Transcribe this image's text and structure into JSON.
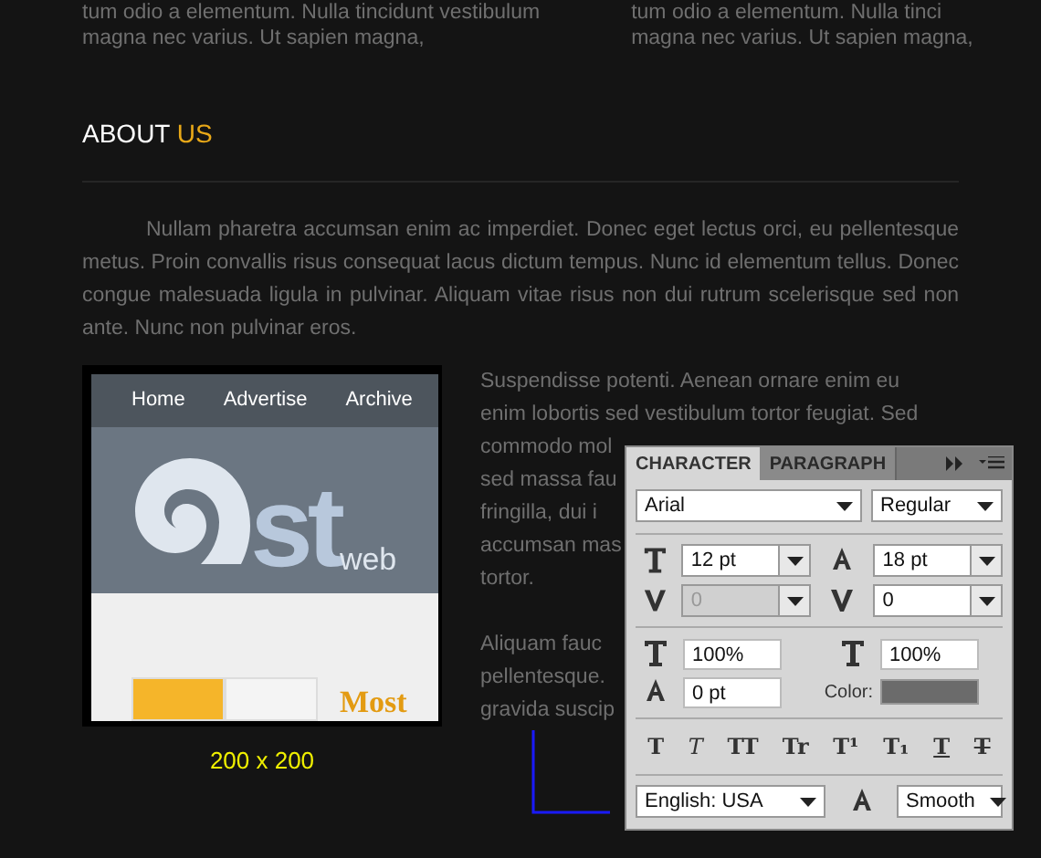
{
  "top_columns": [
    {
      "lines": [
        "tum odio a elementum. Nulla tincidunt vestibulum",
        "magna nec varius. Ut sapien magna,"
      ]
    },
    {
      "lines": [
        "tum odio a elementum. Nulla tinci",
        "magna nec varius. Ut sapien magna,"
      ]
    }
  ],
  "section": {
    "title_plain": "ABOUT",
    "title_accent": "US"
  },
  "intro": "Nullam pharetra accumsan enim ac imperdiet. Donec eget lectus orci, eu pellentesque metus. Proin convallis risus consequat lacus dictum tempus. Nunc id elementum tellus. Donec congue malesuada ligula in pulvinar. Aliquam vitae risus non dui rutrum scelerisque sed non ante. Nunc non pulvinar eros.",
  "thumbnail": {
    "nav": [
      "Home",
      "Advertise",
      "Archive"
    ],
    "logo_letters": "st",
    "logo_sub": "web",
    "heading": "Most",
    "caption": "200 x 200"
  },
  "side_text": {
    "paragraphs": [
      [
        "Suspendisse potenti. Aenean ornare enim eu",
        "enim lobortis sed vestibulum tortor feugiat. Sed",
        "commodo mol",
        "sed massa fau",
        "fringilla, dui i",
        "accumsan mas",
        "tortor."
      ],
      [
        "Aliquam fauc",
        "pellentesque.",
        "gravida suscip"
      ]
    ]
  },
  "panel": {
    "tabs": [
      {
        "label": "CHARACTER",
        "selected": true
      },
      {
        "label": "PARAGRAPH",
        "selected": false
      }
    ],
    "font_family": "Arial",
    "font_style": "Regular",
    "size": "12 pt",
    "leading": "18 pt",
    "kerning": {
      "value": "0",
      "disabled": true
    },
    "tracking": {
      "value": "0",
      "disabled": false
    },
    "vertical_scale": "100%",
    "horizontal_scale": "100%",
    "baseline_shift": "0 pt",
    "color_label": "Color:",
    "color": "#6b6b6b",
    "style_buttons": [
      {
        "kind": "bold",
        "glyph": "T"
      },
      {
        "kind": "italic",
        "glyph": "T"
      },
      {
        "kind": "allcaps",
        "glyph": "TT"
      },
      {
        "kind": "smallcaps",
        "glyph": "Tr"
      },
      {
        "kind": "superscript",
        "glyph": "T¹"
      },
      {
        "kind": "subscript",
        "glyph": "T₁"
      },
      {
        "kind": "underline",
        "glyph": "T"
      },
      {
        "kind": "strike",
        "glyph": "T"
      }
    ],
    "language": "English: USA",
    "antialias": "Smooth"
  }
}
